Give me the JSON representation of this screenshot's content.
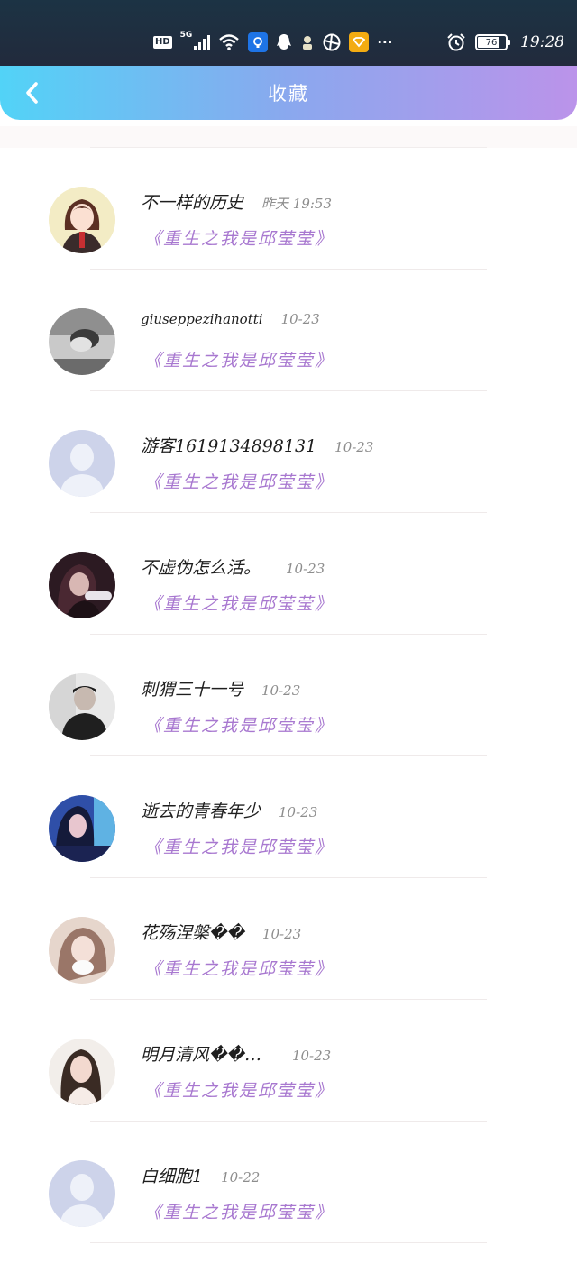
{
  "status_bar": {
    "hd": "HD",
    "network": "5G",
    "more": "···",
    "battery": "76",
    "time": "19:28",
    "icons": [
      "hd-icon",
      "signal-icon",
      "wifi-icon",
      "shield-app-icon",
      "qq-icon",
      "cat-icon",
      "browser-icon",
      "gold-app-icon",
      "more-icon",
      "alarm-icon",
      "battery-icon"
    ]
  },
  "header": {
    "title": "收藏",
    "back_icon": "chevron-left-icon"
  },
  "favorites": [
    {
      "username": "不一样的历史",
      "time": "昨天 19:53",
      "book": "《重生之我是邱莹莹》",
      "avatar": "illustrated-girl"
    },
    {
      "username": "giuseppezihanotti",
      "time": "10-23",
      "book": "《重生之我是邱莹莹》",
      "avatar": "bw-photo"
    },
    {
      "username": "游客1619134898131",
      "time": "10-23",
      "book": "《重生之我是邱莹莹》",
      "avatar": "default"
    },
    {
      "username": "不虚伪怎么活。",
      "time": "10-23",
      "book": "《重生之我是邱莹莹》",
      "avatar": "dark-photo"
    },
    {
      "username": "刺猬三十一号",
      "time": "10-23",
      "book": "《重生之我是邱莹莹》",
      "avatar": "mono-photo"
    },
    {
      "username": "逝去的青春年少",
      "time": "10-23",
      "book": "《重生之我是邱莹莹》",
      "avatar": "blue-photo"
    },
    {
      "username": "花殇涅槃��",
      "time": "10-23",
      "book": "《重生之我是邱莹莹》",
      "avatar": "light-photo"
    },
    {
      "username": "明月清风��…",
      "time": "10-23",
      "book": "《重生之我是邱莹莹》",
      "avatar": "girl-photo"
    },
    {
      "username": "白细胞1",
      "time": "10-22",
      "book": "《重生之我是邱莹莹》",
      "avatar": "default"
    }
  ],
  "colors": {
    "header_gradient_start": "#52d3f7",
    "header_gradient_end": "#bb93ea",
    "book_title": "#a878d0"
  }
}
